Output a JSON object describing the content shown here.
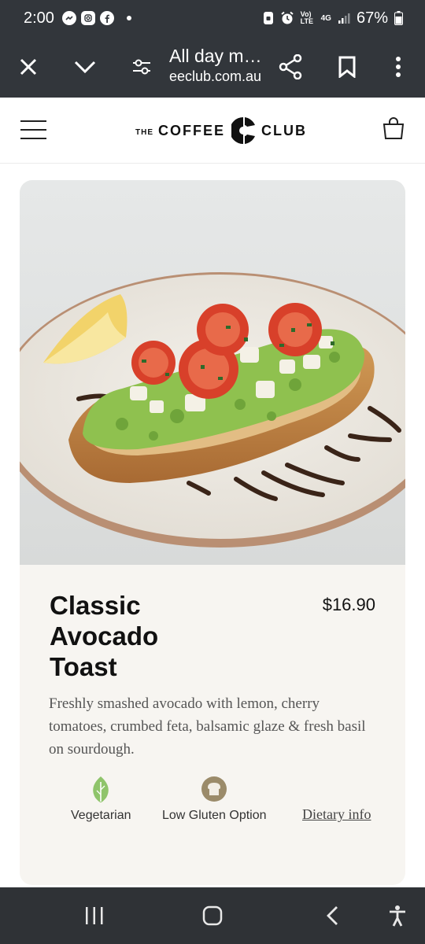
{
  "status_bar": {
    "time": "2:00",
    "battery": "67%",
    "network_label": "4G",
    "volte_label": "Vo) LTE"
  },
  "browser": {
    "title": "All day m…",
    "domain": "eeclub.com.au"
  },
  "site": {
    "logo_the": "THE",
    "logo_coffee": "COFFEE",
    "logo_club": "CLUB"
  },
  "product": {
    "name_lines": [
      "Classic",
      "Avocado",
      "Toast"
    ],
    "price": "$16.90",
    "description": "Freshly smashed avocado with lemon, cherry tomatoes, crumbed feta, balsamic glaze & fresh basil on sourdough.",
    "dietary": [
      {
        "label": "Vegetarian",
        "icon": "leaf-icon",
        "color": "#8fc46b"
      },
      {
        "label": "Low Gluten Option",
        "icon": "bread-icon",
        "color": "#9b8b6a"
      }
    ],
    "dietary_link": "Dietary info"
  },
  "colors": {
    "system_bar": "#32363b",
    "card_bg": "#f7f5f1",
    "nav_bar": "#2f3236"
  }
}
